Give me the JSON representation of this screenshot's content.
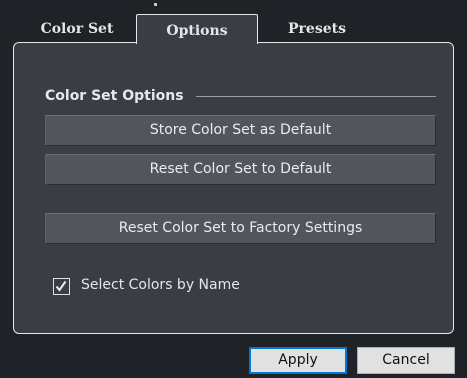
{
  "tabs": [
    {
      "label": "Color Set",
      "active": false
    },
    {
      "label": "Options",
      "active": true
    },
    {
      "label": "Presets",
      "active": false
    }
  ],
  "panel": {
    "section_title": "Color Set Options",
    "buttons": [
      {
        "label": "Store Color Set as Default"
      },
      {
        "label": "Reset Color Set to Default"
      },
      {
        "label": "Reset Color Set to Factory Settings"
      }
    ],
    "checkbox": {
      "label": "Select Colors by Name",
      "checked": true
    }
  },
  "footer": {
    "apply_label": "Apply",
    "cancel_label": "Cancel"
  },
  "colors": {
    "window_bg": "#1f2226",
    "panel_bg": "#3a3e44",
    "button_bg": "#52565c",
    "default_button_border": "#0078d7"
  },
  "icons": {
    "checkbox_mark": "check-icon"
  }
}
